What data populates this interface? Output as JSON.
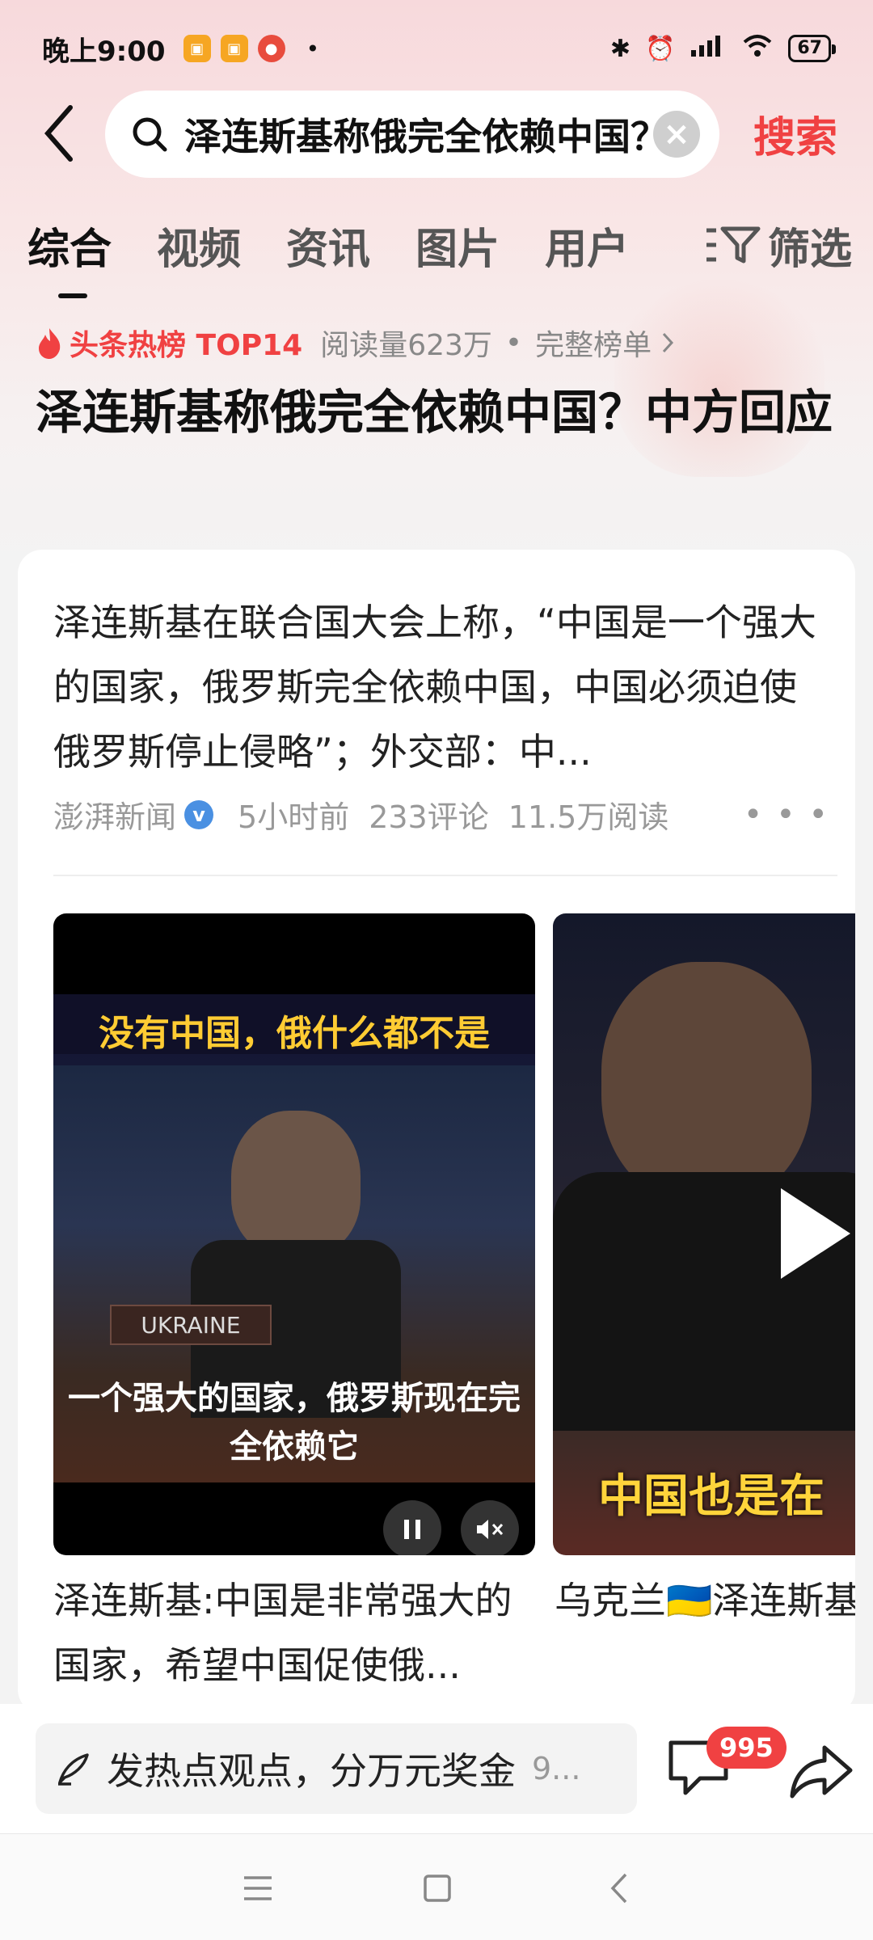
{
  "status_bar": {
    "time": "晚上9:00",
    "dot": "•",
    "battery": "67"
  },
  "search": {
    "query": "泽连斯基称俄完全依赖中国？中方回应",
    "submit_label": "搜索"
  },
  "tabs": [
    {
      "label": "综合",
      "active": true
    },
    {
      "label": "视频"
    },
    {
      "label": "资讯"
    },
    {
      "label": "图片"
    },
    {
      "label": "用户"
    }
  ],
  "filter_label": "筛选",
  "hot_rank": {
    "label": "头条热榜 TOP14",
    "reads": "阅读量623万",
    "separator": "•",
    "full_list": "完整榜单"
  },
  "headline": "泽连斯基称俄完全依赖中国？中方回应",
  "card": {
    "summary": "泽连斯基在联合国大会上称，“中国是一个强大的国家，俄罗斯完全依赖中国，中国必须迫使俄罗斯停止侵略”；外交部：中...",
    "source": "澎湃新闻",
    "time": "5小时前",
    "comments": "233评论",
    "reads": "11.5万阅读",
    "videos": [
      {
        "top_caption": "没有中国，俄什么都不是",
        "nameplate": "UKRAINE",
        "bottom_caption": "一个强大的国家，俄罗斯现在完全依赖它",
        "title": "泽连斯基:中国是非常强大的国家，希望中国促使俄..."
      },
      {
        "caption": "中国也是在",
        "title": "乌克兰🇺🇦泽连斯基在联合国说：俄罗斯🇷🇺"
      }
    ]
  },
  "action_bar": {
    "comment_placeholder": "发热点观点，分万元奖金",
    "comment_suffix": "9...",
    "badge_count": "995"
  },
  "colors": {
    "accent": "#f04142",
    "verified": "#4a90e2"
  }
}
